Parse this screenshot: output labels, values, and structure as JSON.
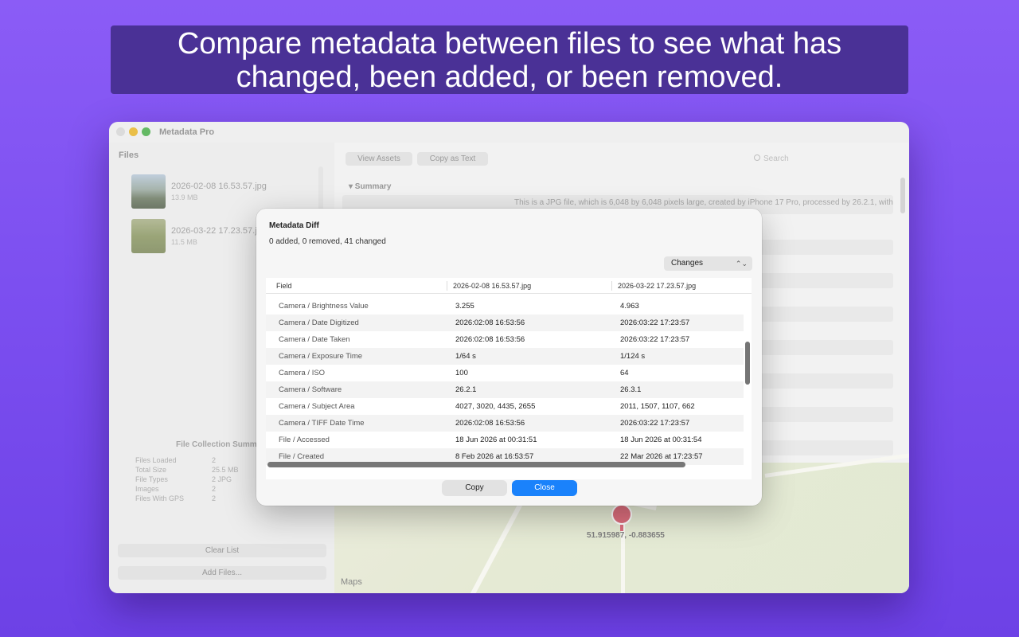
{
  "banner": {
    "line1": "Compare metadata between files to see what has",
    "line2": "changed, been added, or been removed."
  },
  "window": {
    "title": "Metadata Pro"
  },
  "sidebar": {
    "header": "Files",
    "files": [
      {
        "name": "2026-02-08 16.53.57.jpg",
        "size": "13.9 MB"
      },
      {
        "name": "2026-03-22 17.23.57.jpg",
        "size": "11.5 MB"
      }
    ],
    "collection_title": "File Collection Summ",
    "stats": [
      {
        "key": "Files Loaded",
        "value": "2"
      },
      {
        "key": "Total Size",
        "value": "25.5 MB"
      },
      {
        "key": "File Types",
        "value": "2 JPG"
      },
      {
        "key": "Images",
        "value": "2"
      },
      {
        "key": "Files With GPS",
        "value": "2"
      }
    ],
    "clear_label": "Clear List",
    "add_label": "Add Files..."
  },
  "toolbar": {
    "view_assets": "View Assets",
    "copy_as_text": "Copy as Text",
    "search_placeholder": "Search"
  },
  "main": {
    "section": "▾ Summary",
    "summary_text": "This is a JPG file, which is 6,048 by 6,048 pixels large, created by iPhone 17 Pro, processed by 26.2.1, with"
  },
  "map": {
    "coords": "51.915987, -0.883655",
    "brand": " Maps"
  },
  "diff": {
    "title": "Metadata Diff",
    "subtitle": "0 added, 0 removed, 41 changed",
    "filter_value": "Changes",
    "columns": [
      "Field",
      "2026-02-08 16.53.57.jpg",
      "2026-03-22 17.23.57.jpg"
    ],
    "rows": [
      [
        "Camera / Brightness Value",
        "3.255",
        "4.963"
      ],
      [
        "Camera / Date Digitized",
        "2026:02:08 16:53:56",
        "2026:03:22 17:23:57"
      ],
      [
        "Camera / Date Taken",
        "2026:02:08 16:53:56",
        "2026:03:22 17:23:57"
      ],
      [
        "Camera / Exposure Time",
        "1/64 s",
        "1/124 s"
      ],
      [
        "Camera / ISO",
        "100",
        "64"
      ],
      [
        "Camera / Software",
        "26.2.1",
        "26.3.1"
      ],
      [
        "Camera / Subject Area",
        "4027, 3020, 4435, 2655",
        "2011, 1507, 1107, 662"
      ],
      [
        "Camera / TIFF Date Time",
        "2026:02:08 16:53:56",
        "2026:03:22 17:23:57"
      ],
      [
        "File / Accessed",
        "18 Jun 2026 at 00:31:51",
        "18 Jun 2026 at 00:31:54"
      ],
      [
        "File / Created",
        "8 Feb 2026 at 16:53:57",
        "22 Mar 2026 at 17:23:57"
      ]
    ],
    "copy_label": "Copy",
    "close_label": "Close"
  }
}
